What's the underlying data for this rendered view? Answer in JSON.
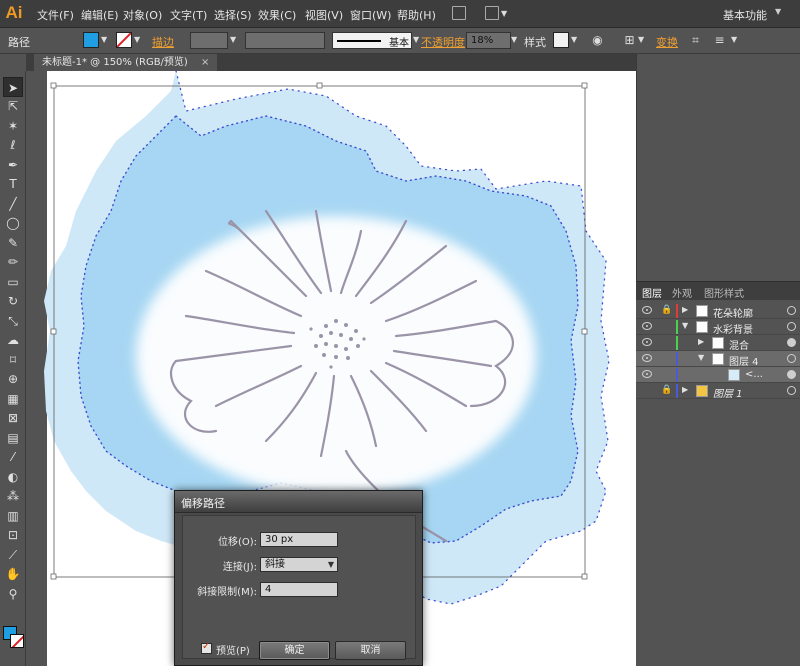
{
  "app": {
    "logo": "Ai",
    "workspace": "基本功能"
  },
  "menu": [
    "文件(F)",
    "编辑(E)",
    "对象(O)",
    "文字(T)",
    "选择(S)",
    "效果(C)",
    "视图(V)",
    "窗口(W)",
    "帮助(H)"
  ],
  "control": {
    "object_type": "路径",
    "stroke_link": "描边",
    "stroke_style": "基本",
    "opacity_link": "不透明度",
    "opacity_value": "18%",
    "style_label": "样式",
    "transform_link": "变换",
    "fill_color": "#1f9fe2"
  },
  "document": {
    "tab_title": "未标题-1* @ 150% (RGB/预览)",
    "close": "×"
  },
  "tools": [
    "selection-icon",
    "direct-selection-icon",
    "magic-wand-icon",
    "lasso-icon",
    "pen-icon",
    "type-icon",
    "line-icon",
    "ellipse-icon",
    "paintbrush-icon",
    "pencil-icon",
    "eraser-icon",
    "rotate-icon",
    "scale-icon",
    "warp-icon",
    "free-transform-icon",
    "shape-builder-icon",
    "perspective-icon",
    "mesh-icon",
    "gradient-icon",
    "eyedropper-icon",
    "blend-icon",
    "symbol-sprayer-icon",
    "column-graph-icon",
    "artboard-icon",
    "slice-icon",
    "hand-icon",
    "zoom-icon"
  ],
  "layers_panel": {
    "tabs": [
      "图层",
      "外观",
      "图形样式"
    ],
    "rows": [
      {
        "name": "花朵轮廓",
        "color": "#e03a3a"
      },
      {
        "name": "水彩背景",
        "color": "#4fd04f"
      },
      {
        "name": "混合",
        "color": "#4fd04f"
      },
      {
        "name": "图层 4",
        "color": "#4a5ad8"
      },
      {
        "name": "<...",
        "color": "#4a5ad8"
      },
      {
        "name": "图层 1",
        "color": "#4a5ad8"
      }
    ]
  },
  "dialog": {
    "title": "偏移路径",
    "offset_label": "位移(O):",
    "offset_value": "30 px",
    "join_label": "连接(J):",
    "join_value": "斜接",
    "miter_label": "斜接限制(M):",
    "miter_value": "4",
    "preview_label": "预览(P)",
    "ok_label": "确定",
    "cancel_label": "取消"
  }
}
